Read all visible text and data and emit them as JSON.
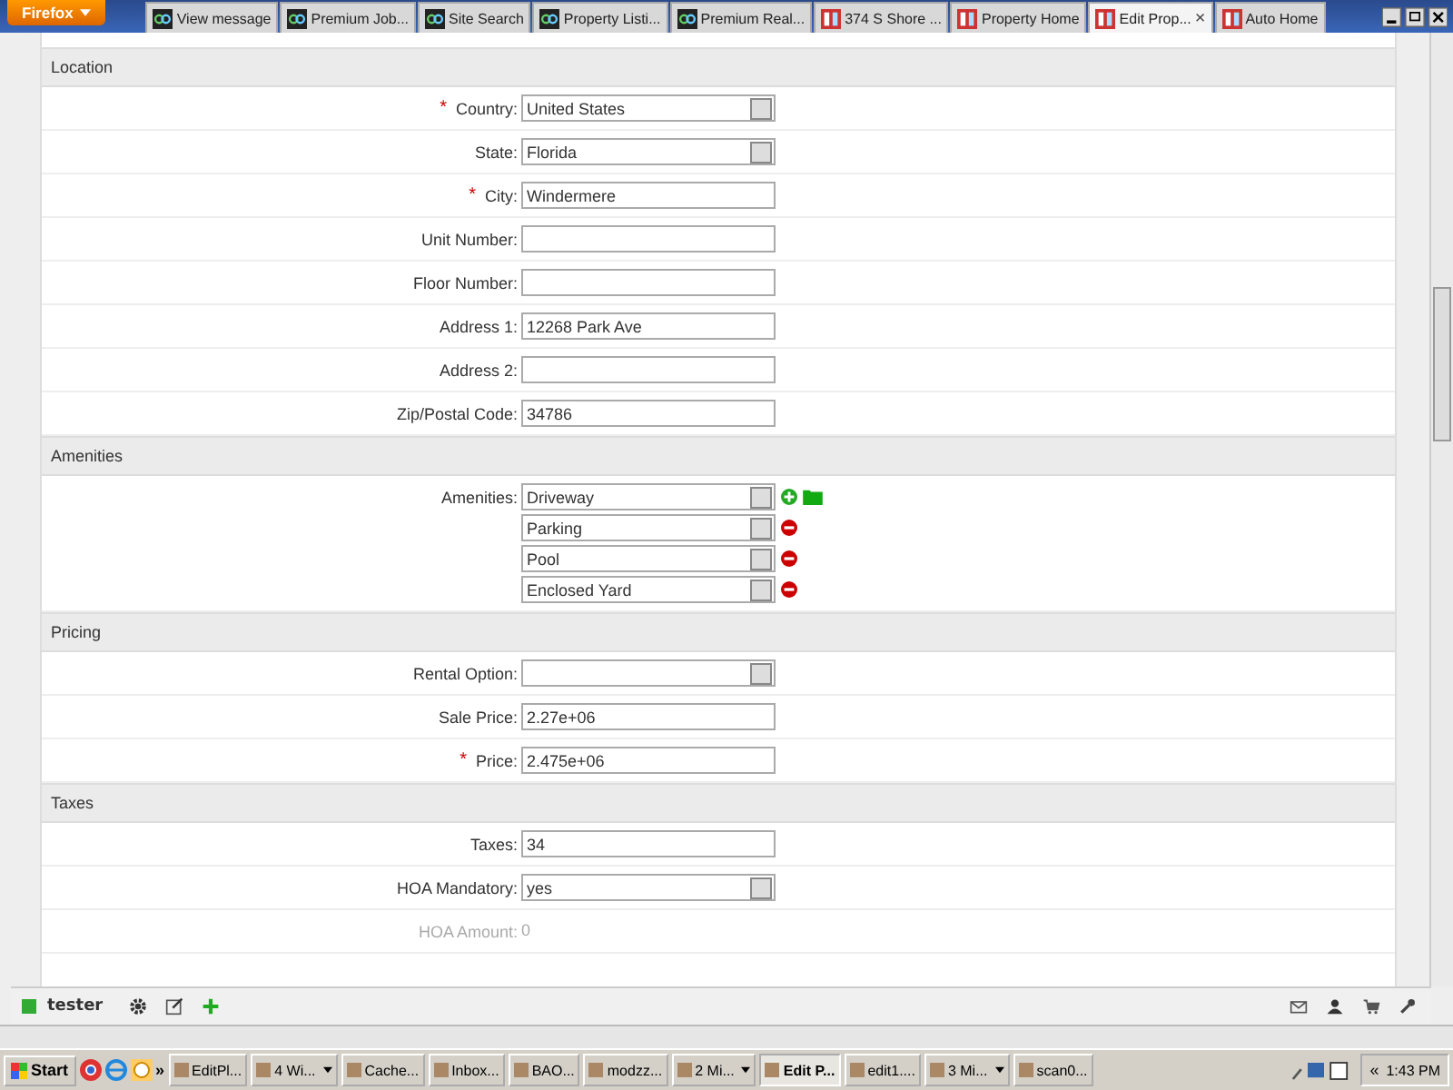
{
  "browser": {
    "menu_button": "Firefox",
    "tabs": [
      {
        "label": "View message",
        "selected": false
      },
      {
        "label": "Premium Job...",
        "selected": false
      },
      {
        "label": "Site Search",
        "selected": false
      },
      {
        "label": "Property Listi...",
        "selected": false
      },
      {
        "label": "Premium Real...",
        "selected": false
      },
      {
        "label": "374 S Shore ...",
        "selected": false
      },
      {
        "label": "Property Home",
        "selected": false
      },
      {
        "label": "Edit Prop...",
        "selected": true
      },
      {
        "label": "Auto Home",
        "selected": false
      }
    ],
    "close_tab": "×"
  },
  "required_mark": "*",
  "sections": [
    {
      "title": "Location",
      "rows": [
        {
          "kind": "select",
          "label": "Country:",
          "required": true,
          "value": "United States"
        },
        {
          "kind": "select",
          "label": "State:",
          "required": false,
          "value": "Florida"
        },
        {
          "kind": "text",
          "label": "City:",
          "required": true,
          "value": "Windermere"
        },
        {
          "kind": "text",
          "label": "Unit Number:",
          "required": false,
          "value": ""
        },
        {
          "kind": "text",
          "label": "Floor Number:",
          "required": false,
          "value": ""
        },
        {
          "kind": "text",
          "label": "Address 1:",
          "required": false,
          "value": "12268 Park Ave"
        },
        {
          "kind": "text",
          "label": "Address 2:",
          "required": false,
          "value": ""
        },
        {
          "kind": "text",
          "label": "Zip/Postal Code:",
          "required": false,
          "value": "34786"
        }
      ]
    },
    {
      "title": "Amenities",
      "rows": [
        {
          "kind": "multi",
          "label": "Amenities:",
          "required": false,
          "items": [
            "Driveway",
            "Parking",
            "Pool",
            "Enclosed Yard"
          ]
        }
      ]
    },
    {
      "title": "Pricing",
      "rows": [
        {
          "kind": "select",
          "label": "Rental Option:",
          "required": false,
          "value": ""
        },
        {
          "kind": "text",
          "label": "Sale Price:",
          "required": false,
          "value": "2.27e+06"
        },
        {
          "kind": "text",
          "label": "Price:",
          "required": true,
          "value": "2.475e+06"
        }
      ]
    },
    {
      "title": "Taxes",
      "rows": [
        {
          "kind": "text",
          "label": "Taxes:",
          "required": false,
          "value": "34"
        },
        {
          "kind": "select",
          "label": "HOA Mandatory:",
          "required": false,
          "value": "yes"
        },
        {
          "kind": "faded",
          "label": "HOA Amount:",
          "required": false,
          "value": "0"
        }
      ]
    }
  ],
  "toolbar": {
    "user": "tester"
  },
  "taskbar": {
    "start": "Start",
    "more": "»",
    "items": [
      {
        "label": "EditPl...",
        "selected": false,
        "group": false
      },
      {
        "label": "4 Wi...",
        "selected": false,
        "group": true
      },
      {
        "label": "Cache...",
        "selected": false,
        "group": false
      },
      {
        "label": "Inbox...",
        "selected": false,
        "group": false
      },
      {
        "label": "BAO...",
        "selected": false,
        "group": false
      },
      {
        "label": "modzz...",
        "selected": false,
        "group": false
      },
      {
        "label": "2 Mi...",
        "selected": false,
        "group": true
      },
      {
        "label": "Edit P...",
        "selected": true,
        "group": false
      },
      {
        "label": "edit1....",
        "selected": false,
        "group": false
      },
      {
        "label": "3 Mi...",
        "selected": false,
        "group": true
      },
      {
        "label": "scan0...",
        "selected": false,
        "group": false
      }
    ],
    "tray_expand": "«",
    "clock": "1:43 PM"
  }
}
